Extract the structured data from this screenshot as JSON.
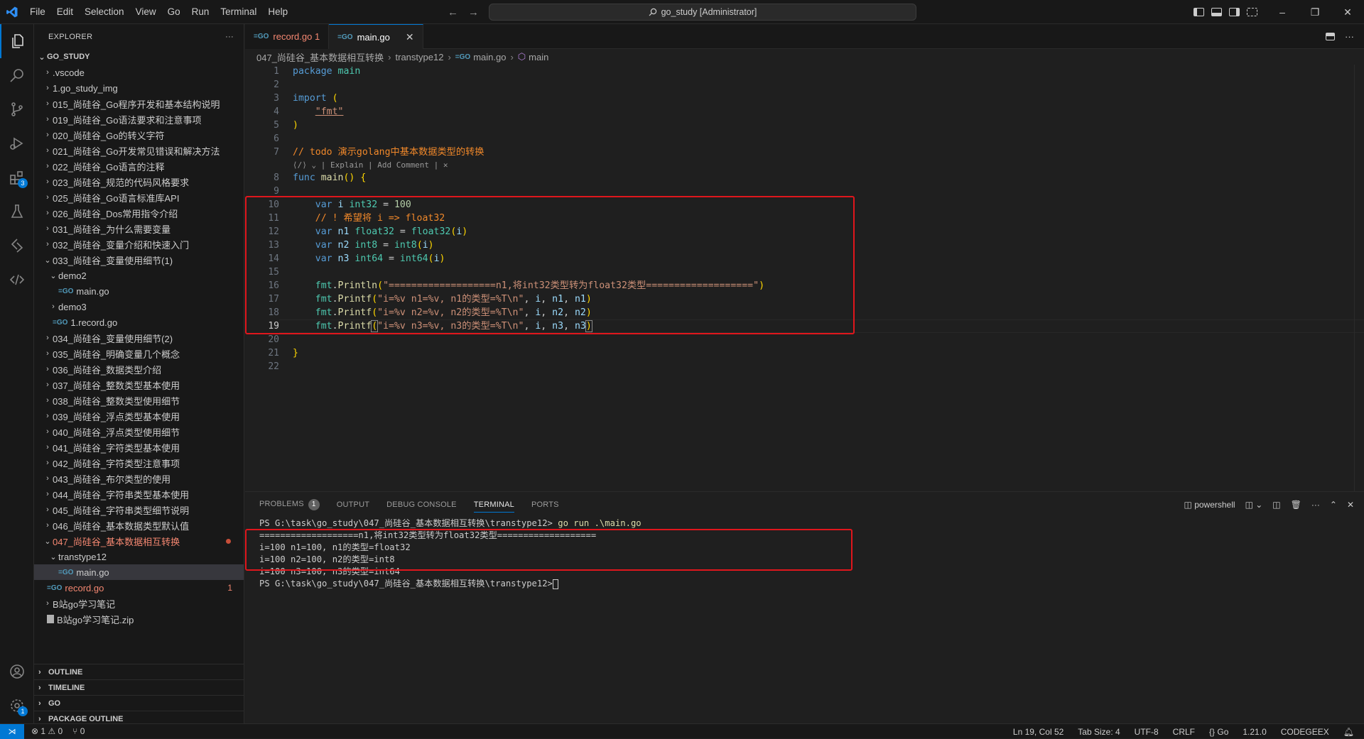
{
  "titlebar": {
    "menu": [
      "File",
      "Edit",
      "Selection",
      "View",
      "Go",
      "Run",
      "Terminal",
      "Help"
    ],
    "search": "go_study [Administrator]"
  },
  "activity": {
    "extensions_badge": "3",
    "settings_badge": "1"
  },
  "explorer": {
    "title": "EXPLORER",
    "more": "···",
    "root": "GO_STUDY",
    "items": [
      {
        "label": ".vscode",
        "indent": 1,
        "chev": "›"
      },
      {
        "label": "1.go_study_img",
        "indent": 1,
        "chev": "›"
      },
      {
        "label": "015_尚硅谷_Go程序开发和基本结构说明",
        "indent": 1,
        "chev": "›"
      },
      {
        "label": "019_尚硅谷_Go语法要求和注意事项",
        "indent": 1,
        "chev": "›"
      },
      {
        "label": "020_尚硅谷_Go的转义字符",
        "indent": 1,
        "chev": "›"
      },
      {
        "label": "021_尚硅谷_Go开发常见错误和解决方法",
        "indent": 1,
        "chev": "›"
      },
      {
        "label": "022_尚硅谷_Go语言的注释",
        "indent": 1,
        "chev": "›"
      },
      {
        "label": "023_尚硅谷_规范的代码风格要求",
        "indent": 1,
        "chev": "›"
      },
      {
        "label": "025_尚硅谷_Go语言标准库API",
        "indent": 1,
        "chev": "›"
      },
      {
        "label": "026_尚硅谷_Dos常用指令介绍",
        "indent": 1,
        "chev": "›"
      },
      {
        "label": "031_尚硅谷_为什么需要变量",
        "indent": 1,
        "chev": "›"
      },
      {
        "label": "032_尚硅谷_变量介绍和快速入门",
        "indent": 1,
        "chev": "›"
      },
      {
        "label": "033_尚硅谷_变量使用细节(1)",
        "indent": 1,
        "chev": "⌄"
      },
      {
        "label": "demo2",
        "indent": 2,
        "chev": "⌄"
      },
      {
        "label": "main.go",
        "indent": 3,
        "go": true
      },
      {
        "label": "demo3",
        "indent": 2,
        "chev": "›"
      },
      {
        "label": "1.record.go",
        "indent": 2,
        "go": true
      },
      {
        "label": "034_尚硅谷_变量使用细节(2)",
        "indent": 1,
        "chev": "›"
      },
      {
        "label": "035_尚硅谷_明确变量几个概念",
        "indent": 1,
        "chev": "›"
      },
      {
        "label": "036_尚硅谷_数据类型介绍",
        "indent": 1,
        "chev": "›"
      },
      {
        "label": "037_尚硅谷_整数类型基本使用",
        "indent": 1,
        "chev": "›"
      },
      {
        "label": "038_尚硅谷_整数类型使用细节",
        "indent": 1,
        "chev": "›"
      },
      {
        "label": "039_尚硅谷_浮点类型基本使用",
        "indent": 1,
        "chev": "›"
      },
      {
        "label": "040_尚硅谷_浮点类型使用细节",
        "indent": 1,
        "chev": "›"
      },
      {
        "label": "041_尚硅谷_字符类型基本使用",
        "indent": 1,
        "chev": "›"
      },
      {
        "label": "042_尚硅谷_字符类型注意事项",
        "indent": 1,
        "chev": "›"
      },
      {
        "label": "043_尚硅谷_布尔类型的使用",
        "indent": 1,
        "chev": "›"
      },
      {
        "label": "044_尚硅谷_字符串类型基本使用",
        "indent": 1,
        "chev": "›"
      },
      {
        "label": "045_尚硅谷_字符串类型细节说明",
        "indent": 1,
        "chev": "›"
      },
      {
        "label": "046_尚硅谷_基本数据类型默认值",
        "indent": 1,
        "chev": "›"
      },
      {
        "label": "047_尚硅谷_基本数据相互转换",
        "indent": 1,
        "chev": "⌄",
        "mod": true,
        "dot": true
      },
      {
        "label": "transtype12",
        "indent": 2,
        "chev": "⌄"
      },
      {
        "label": "main.go",
        "indent": 3,
        "go": true,
        "sel": true
      },
      {
        "label": "record.go",
        "indent": 1,
        "go": true,
        "mod": true,
        "tail": "1"
      },
      {
        "label": "B站go学习笔记",
        "indent": 1,
        "chev": "›"
      },
      {
        "label": "B站go学习笔记.zip",
        "indent": 1,
        "zip": true
      }
    ],
    "sections": [
      "OUTLINE",
      "TIMELINE",
      "GO",
      "PACKAGE OUTLINE"
    ]
  },
  "tabs": [
    {
      "label": "record.go 1",
      "active": false
    },
    {
      "label": "main.go",
      "active": true
    }
  ],
  "breadcrumb": [
    "047_尚硅谷_基本数据相互转换",
    "transtype12",
    "main.go",
    "main"
  ],
  "editor": {
    "line_numbers": [
      "1",
      "2",
      "3",
      "4",
      "5",
      "6",
      "7",
      "8",
      "9",
      "10",
      "11",
      "12",
      "13",
      "14",
      "15",
      "16",
      "17",
      "18",
      "19",
      "20",
      "21",
      "22"
    ],
    "codelens": "⟨/⟩ ⌄ | Explain | Add Comment | ✕",
    "current_line": "19"
  },
  "panel": {
    "tabs": [
      "PROBLEMS",
      "OUTPUT",
      "DEBUG CONSOLE",
      "TERMINAL",
      "PORTS"
    ],
    "problems_count": "1",
    "shell": "powershell",
    "terminal": {
      "prompt1": "PS G:\\task\\go_study\\047_尚硅谷_基本数据相互转换\\transtype12>",
      "cmd1": " go run .\\main.go",
      "out": [
        "===================n1,将int32类型转为float32类型===================",
        "i=100 n1=100, n1的类型=float32",
        "i=100 n2=100, n2的类型=int8",
        "i=100 n3=100, n3的类型=int64"
      ],
      "prompt2": "PS G:\\task\\go_study\\047_尚硅谷_基本数据相互转换\\transtype12>"
    }
  },
  "status": {
    "errors": "⊗ 1",
    "warnings": "⚠ 0",
    "ports": "⑂ 0",
    "position": "Ln 19, Col 52",
    "tabsize": "Tab Size: 4",
    "encoding": "UTF-8",
    "eol": "CRLF",
    "language": "{} Go",
    "goversion": "1.21.0",
    "codegeex": "CODEGEEX"
  }
}
